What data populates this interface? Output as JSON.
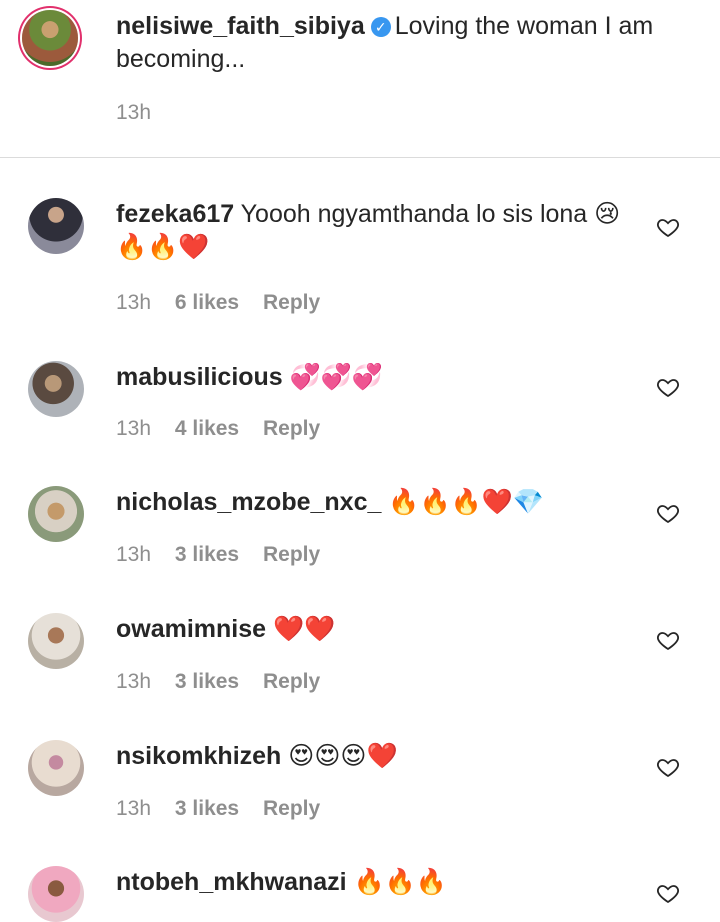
{
  "caption": {
    "username": "nelisiwe_faith_sibiya",
    "verified_icon": "verified-badge-icon",
    "text": "Loving the woman I am becoming...",
    "time": "13h"
  },
  "comments": [
    {
      "username": "fezeka617",
      "text": "Yoooh ngyamthanda lo sis lona 😢🔥🔥❤️",
      "time": "13h",
      "likes": "6 likes",
      "reply": "Reply"
    },
    {
      "username": "mabusilicious",
      "text": "💞💞💞",
      "time": "13h",
      "likes": "4 likes",
      "reply": "Reply"
    },
    {
      "username": "nicholas_mzobe_nxc_",
      "text": "🔥🔥🔥❤️💎",
      "time": "13h",
      "likes": "3 likes",
      "reply": "Reply"
    },
    {
      "username": "owamimnise",
      "text": "❤️❤️",
      "time": "13h",
      "likes": "3 likes",
      "reply": "Reply"
    },
    {
      "username": "nsikomkhizeh",
      "text": "😍😍😍❤️",
      "time": "13h",
      "likes": "3 likes",
      "reply": "Reply"
    },
    {
      "username": "ntobeh_mkhwanazi",
      "text": "🔥🔥🔥",
      "time": "",
      "likes": "",
      "reply": ""
    }
  ],
  "colors": {
    "text": "#262626",
    "secondary": "#8e8e8e",
    "verified": "#3897f0",
    "divider": "#dbdbdb"
  }
}
